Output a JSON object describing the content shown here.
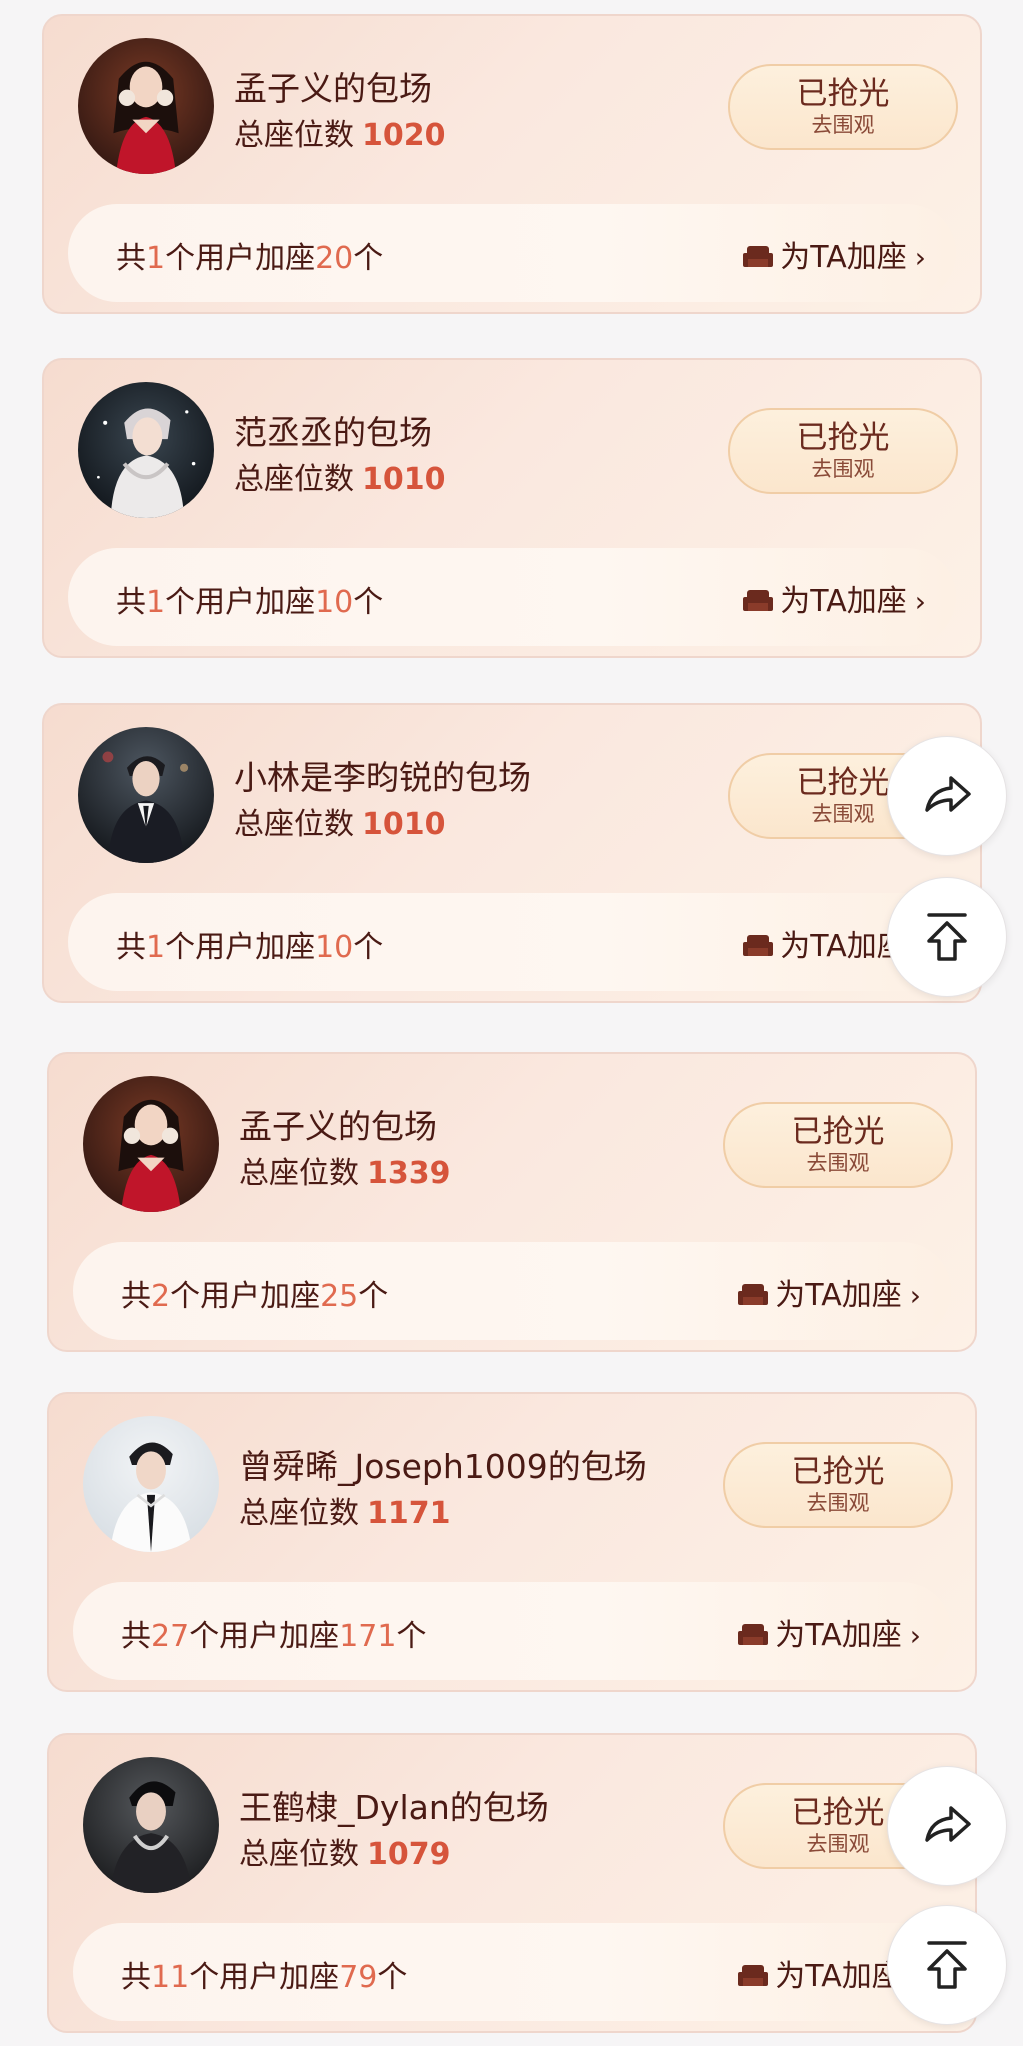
{
  "cards": [
    {
      "title": "孟子义的包场",
      "seat_label": "总座位数",
      "seat_count": "1020",
      "sold_main": "已抢光",
      "sold_sub": "去围观",
      "info_prefix": "共",
      "info_users": "1",
      "info_mid": "个用户加座",
      "info_seats": "20",
      "info_suffix": "个",
      "add_label": "为TA加座",
      "avatar_icon": "avatar-red-dress-woman"
    },
    {
      "title": "范丞丞的包场",
      "seat_label": "总座位数",
      "seat_count": "1010",
      "sold_main": "已抢光",
      "sold_sub": "去围观",
      "info_prefix": "共",
      "info_users": "1",
      "info_mid": "个用户加座",
      "info_seats": "10",
      "info_suffix": "个",
      "add_label": "为TA加座",
      "avatar_icon": "avatar-white-hoodie-man"
    },
    {
      "title": "小林是李昀锐的包场",
      "seat_label": "总座位数",
      "seat_count": "1010",
      "sold_main": "已抢光",
      "sold_sub": "去围观",
      "info_prefix": "共",
      "info_users": "1",
      "info_mid": "个用户加座",
      "info_seats": "10",
      "info_suffix": "个",
      "add_label": "为TA加座",
      "avatar_icon": "avatar-suit-man-night"
    },
    {
      "title": "孟子义的包场",
      "seat_label": "总座位数",
      "seat_count": "1339",
      "sold_main": "已抢光",
      "sold_sub": "去围观",
      "info_prefix": "共",
      "info_users": "2",
      "info_mid": "个用户加座",
      "info_seats": "25",
      "info_suffix": "个",
      "add_label": "为TA加座",
      "avatar_icon": "avatar-red-dress-woman"
    },
    {
      "title": "曾舜晞_Joseph1009的包场",
      "seat_label": "总座位数",
      "seat_count": "1171",
      "sold_main": "已抢光",
      "sold_sub": "去围观",
      "info_prefix": "共",
      "info_users": "27",
      "info_mid": "个用户加座",
      "info_seats": "171",
      "info_suffix": "个",
      "add_label": "为TA加座",
      "avatar_icon": "avatar-white-shirt-tie-man"
    },
    {
      "title": "王鹤棣_Dylan的包场",
      "seat_label": "总座位数",
      "seat_count": "1079",
      "sold_main": "已抢光",
      "sold_sub": "去围观",
      "info_prefix": "共",
      "info_users": "11",
      "info_mid": "个用户加座",
      "info_seats": "79",
      "info_suffix": "个",
      "add_label": "为TA加座",
      "avatar_icon": "avatar-dark-suit-man"
    }
  ],
  "floating": {
    "share_icon": "share-arrow-icon",
    "top_icon": "back-to-top-icon"
  },
  "colors": {
    "accent": "#d6543b",
    "highlight": "#e06a4f",
    "text_dark": "#4a1a14",
    "card_bg": "#f9e4d8"
  }
}
